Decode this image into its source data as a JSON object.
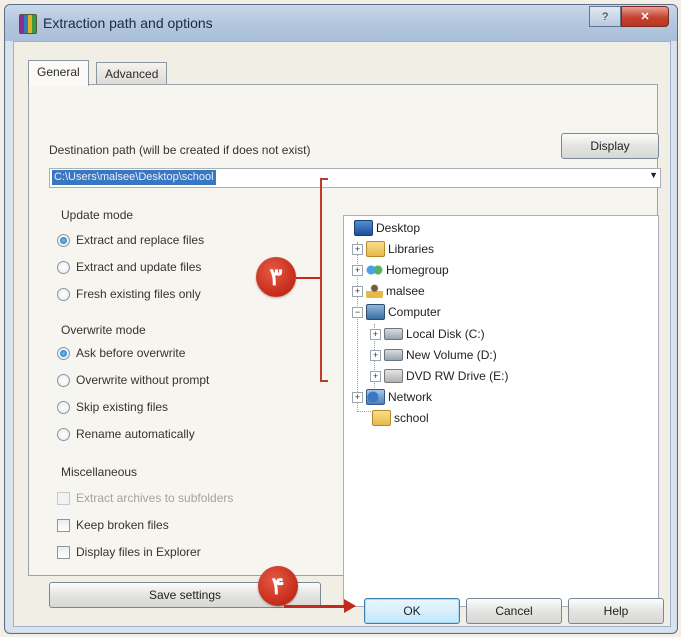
{
  "window": {
    "title": "Extraction path and options"
  },
  "tabs": [
    {
      "label": "General"
    },
    {
      "label": "Advanced"
    }
  ],
  "destination": {
    "label": "Destination path (will be created if does not exist)",
    "path_value": "C:\\Users\\malsee\\Desktop\\school",
    "display_button": "Display"
  },
  "update_mode": {
    "label": "Update mode",
    "options": [
      {
        "label": "Extract and replace files",
        "selected": true
      },
      {
        "label": "Extract and update files",
        "selected": false
      },
      {
        "label": "Fresh existing files only",
        "selected": false
      }
    ]
  },
  "overwrite_mode": {
    "label": "Overwrite mode",
    "options": [
      {
        "label": "Ask before overwrite",
        "selected": true
      },
      {
        "label": "Overwrite without prompt",
        "selected": false
      },
      {
        "label": "Skip existing files",
        "selected": false
      },
      {
        "label": "Rename automatically",
        "selected": false
      }
    ]
  },
  "misc": {
    "label": "Miscellaneous",
    "options": [
      {
        "label": "Extract archives to subfolders",
        "checked": false,
        "disabled": true
      },
      {
        "label": "Keep broken files",
        "checked": false,
        "disabled": false
      },
      {
        "label": "Display files in Explorer",
        "checked": false,
        "disabled": false
      }
    ]
  },
  "save_button": "Save settings",
  "tree": {
    "nodes": [
      {
        "label": "Desktop",
        "icon": "desktop-icon"
      },
      {
        "label": "Libraries",
        "icon": "libraries-icon"
      },
      {
        "label": "Homegroup",
        "icon": "homegroup-icon"
      },
      {
        "label": "malsee",
        "icon": "user-folder-icon"
      },
      {
        "label": "Computer",
        "icon": "computer-icon"
      },
      {
        "label": "Local Disk (C:)",
        "icon": "disk-icon"
      },
      {
        "label": "New Volume (D:)",
        "icon": "disk-icon"
      },
      {
        "label": "DVD RW Drive (E:)",
        "icon": "dvd-icon"
      },
      {
        "label": "Network",
        "icon": "network-icon"
      },
      {
        "label": "school",
        "icon": "folder-icon"
      }
    ]
  },
  "footer": {
    "ok": "OK",
    "cancel": "Cancel",
    "help": "Help"
  },
  "callouts": {
    "three": "۳",
    "four": "۴"
  },
  "colors": {
    "callout": "#c42a1a",
    "selection": "#3a77c2"
  }
}
